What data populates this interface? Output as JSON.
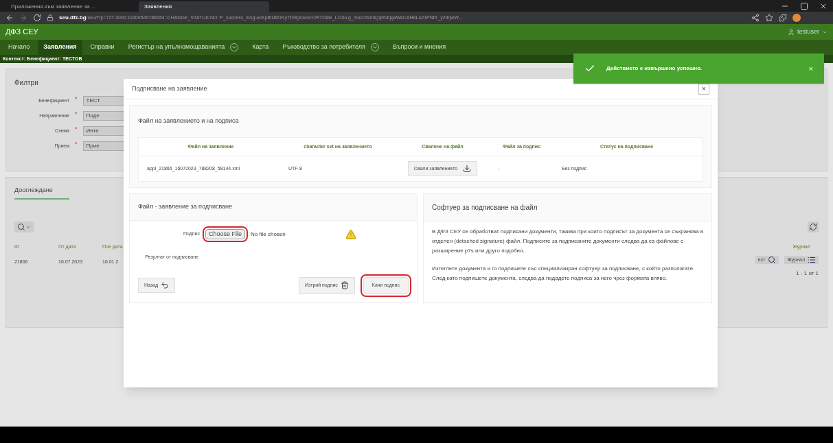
{
  "browser": {
    "tabs": [
      {
        "label": "Приложения към заявление за ...",
        "selected": false
      },
      {
        "label": "Заявления",
        "selected": true
      }
    ],
    "url_domain": "seu.dfz.bg",
    "url_rest": "/seu/f?p=727:4000:11600549786654::CHANGE_STATUS:NO::P_success_msg:a0Xp8tU6OKy7D9Qn4vw:OR7Odle_I-O3u.g_/vncOtsmiQqtrb6pjaWkCAH8Lo21PNfX_y2tlrjwW..."
  },
  "app": {
    "title": "ДФЗ СЕУ",
    "user": "testuser"
  },
  "nav": [
    {
      "label": "Начало",
      "selected": false,
      "dropdown": false
    },
    {
      "label": "Заявления",
      "selected": true,
      "dropdown": false
    },
    {
      "label": "Справки",
      "selected": false,
      "dropdown": false
    },
    {
      "label": "Регистър на упълномощаванията",
      "selected": false,
      "dropdown": true
    },
    {
      "label": "Карта",
      "selected": false,
      "dropdown": false
    },
    {
      "label": "Ръководство за потребителя",
      "selected": false,
      "dropdown": true
    },
    {
      "label": "Въпроси и мнения",
      "selected": false,
      "dropdown": false
    }
  ],
  "context": "Контекст: Бенефициент: ТЕСТОВ",
  "toast": {
    "message": "Действието е извършено успешно.",
    "close": "×"
  },
  "filters": {
    "title": "Филтри",
    "fields": [
      {
        "label": "Бенефициент",
        "required_mark": "*",
        "value": "ТЕСТ"
      },
      {
        "label": "Направление",
        "required_mark": "*",
        "value": "Поде"
      },
      {
        "label": "Схема",
        "required_mark": "*",
        "value": "Инте"
      },
      {
        "label": "Прием",
        "required_mark": "*",
        "value": "Прие"
      }
    ]
  },
  "page_tab": "Дооглеждане",
  "table": {
    "columns": [
      "ID",
      "От дата",
      "Пое дата"
    ],
    "row": [
      "21866",
      "16.07.2023",
      "16.01.2"
    ],
    "right_column": "Журнал",
    "search_button": "ест",
    "journal_button": "Журнал",
    "pagination": "1 - 1 от 1"
  },
  "modal": {
    "title": "Подписване на заявление",
    "close": "×",
    "files_section": {
      "title": "Файл на заявлението и на подписа",
      "columns": [
        "Файл на заявление",
        "character set на заявлението",
        "Сваляне на файл",
        "Файл за подпис",
        "Статус на подписване"
      ],
      "row": {
        "file": "appl_21866_16072023_788208_58144.xml",
        "charset": "UTF-8",
        "download": "Свали заявлението",
        "signature_file": "-",
        "status": "Без подпис"
      }
    },
    "sign_section": {
      "title": "Файл - заявление за подписване",
      "signature_label": "Подпис",
      "choose_file": {
        "label": "Choose File",
        "highlighted": true
      },
      "no_file": "No file chosen",
      "result_label": "Резултат от подписване",
      "back": "Назад",
      "delete": "Изтрий подпис",
      "upload": {
        "label": "Качи подпис",
        "highlighted": true
      }
    },
    "software_section": {
      "title": "Софтуер за подписване на файл",
      "paragraphs": [
        "В ДФЗ СЕУ се обработват подписани документи, такива при които подписът за документа се съхранява в отделен (detached signature) файл. Подписите за подписаните документи следва да са файлове с разширение p7s или друго подобно.",
        "Изтеглете документа и го подпишете със специализиран софтуер за подписване, с който разполагате. След като подпишете документа, следва да подадете подписа за него чрез формата вляво."
      ]
    }
  }
}
